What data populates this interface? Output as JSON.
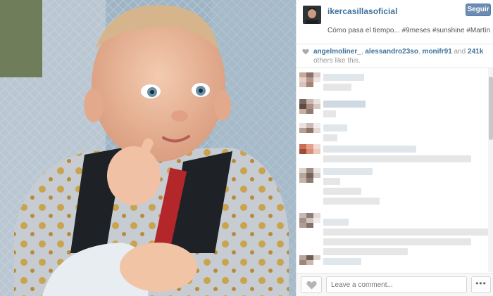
{
  "post": {
    "username": "ikercasillasoficial",
    "follow_label": "Seguir",
    "caption": "Cómo pasa el tiempo... #9meses #sunshine #Martín",
    "photo_alt": "baby in stroller"
  },
  "likes": {
    "user1": "angelmoliner_",
    "sep1": ", ",
    "user2": "alessandro23so",
    "sep2": ", ",
    "user3": "monifr91",
    "and_text": " and ",
    "count": "241k",
    "tail": " others like this."
  },
  "footer": {
    "comment_placeholder": "Leave a comment...",
    "more_label": "•••"
  },
  "colors": {
    "link_blue": "#3f729b",
    "follow_button": "#6b8cb3"
  },
  "icons": {
    "like": "heart-icon",
    "more": "ellipsis-icon"
  }
}
